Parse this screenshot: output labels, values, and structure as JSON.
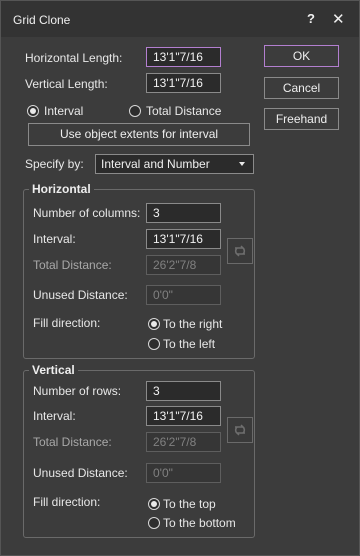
{
  "dialog": {
    "title": "Grid Clone",
    "help_symbol": "?",
    "close_symbol": "✕"
  },
  "top": {
    "horizontal_length_label": "Horizontal Length:",
    "horizontal_length_value": "13'1\"7/16",
    "vertical_length_label": "Vertical Length:",
    "vertical_length_value": "13'1\"7/16",
    "radio_interval": "Interval",
    "radio_total_distance": "Total Distance",
    "selected_mode": "Interval",
    "extents_button": "Use object extents for interval",
    "specify_label": "Specify by:",
    "specify_value": "Interval and Number"
  },
  "buttons": {
    "ok": "OK",
    "cancel": "Cancel",
    "freehand": "Freehand"
  },
  "horizontal": {
    "title": "Horizontal",
    "count_label": "Number of columns:",
    "count_value": "3",
    "interval_label": "Interval:",
    "interval_value": "13'1\"7/16",
    "total_label": "Total Distance:",
    "total_value": "26'2\"7/8",
    "unused_label": "Unused Distance:",
    "unused_value": "0'0\"",
    "fill_label": "Fill direction:",
    "fill_option_1": "To the right",
    "fill_option_2": "To the left",
    "fill_selected": "To the right"
  },
  "vertical": {
    "title": "Vertical",
    "count_label": "Number of rows:",
    "count_value": "3",
    "interval_label": "Interval:",
    "interval_value": "13'1\"7/16",
    "total_label": "Total Distance:",
    "total_value": "26'2\"7/8",
    "unused_label": "Unused Distance:",
    "unused_value": "0'0\"",
    "fill_label": "Fill direction:",
    "fill_option_1": "To the top",
    "fill_option_2": "To the bottom",
    "fill_selected": "To the top"
  },
  "icons": {
    "swap": "swap-icon",
    "dropdown": "chevron-down-icon"
  },
  "colors": {
    "background": "#3c3c3c",
    "accent": "#b37fd0"
  }
}
